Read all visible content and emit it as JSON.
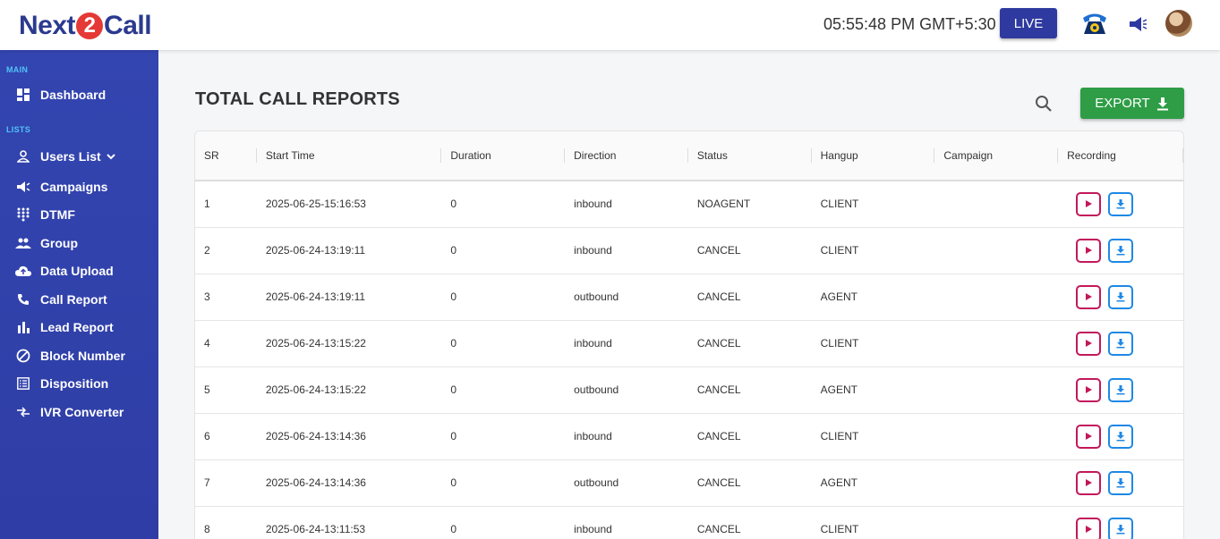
{
  "brand": {
    "pre": "Next",
    "mid": "2",
    "post": "Call"
  },
  "header": {
    "clock": "05:55:48 PM GMT+5:30",
    "live_label": "LIVE"
  },
  "sidebar": {
    "main_label": "MAIN",
    "lists_label": "LISTS",
    "items": [
      {
        "label": "Dashboard",
        "icon": "dashboard-icon"
      },
      {
        "label": "Users List",
        "icon": "user-icon"
      },
      {
        "label": "Campaigns",
        "icon": "megaphone-icon"
      },
      {
        "label": "DTMF",
        "icon": "dialpad-icon"
      },
      {
        "label": "Group",
        "icon": "group-icon"
      },
      {
        "label": "Data Upload",
        "icon": "cloud-upload-icon"
      },
      {
        "label": "Call Report",
        "icon": "phone-icon"
      },
      {
        "label": "Lead Report",
        "icon": "bar-chart-icon"
      },
      {
        "label": "Block Number",
        "icon": "block-icon"
      },
      {
        "label": "Disposition",
        "icon": "list-icon"
      },
      {
        "label": "IVR Converter",
        "icon": "convert-icon"
      }
    ]
  },
  "main": {
    "title": "TOTAL CALL REPORTS",
    "export_label": "EXPORT"
  },
  "table": {
    "columns": [
      "SR",
      "Start Time",
      "Duration",
      "Direction",
      "Status",
      "Hangup",
      "Campaign",
      "Recording"
    ],
    "rows": [
      [
        "1",
        "2025-06-25-15:16:53",
        "0",
        "inbound",
        "NOAGENT",
        "CLIENT",
        ""
      ],
      [
        "2",
        "2025-06-24-13:19:11",
        "0",
        "inbound",
        "CANCEL",
        "CLIENT",
        ""
      ],
      [
        "3",
        "2025-06-24-13:19:11",
        "0",
        "outbound",
        "CANCEL",
        "AGENT",
        ""
      ],
      [
        "4",
        "2025-06-24-13:15:22",
        "0",
        "inbound",
        "CANCEL",
        "CLIENT",
        ""
      ],
      [
        "5",
        "2025-06-24-13:15:22",
        "0",
        "outbound",
        "CANCEL",
        "AGENT",
        ""
      ],
      [
        "6",
        "2025-06-24-13:14:36",
        "0",
        "inbound",
        "CANCEL",
        "CLIENT",
        ""
      ],
      [
        "7",
        "2025-06-24-13:14:36",
        "0",
        "outbound",
        "CANCEL",
        "AGENT",
        ""
      ],
      [
        "8",
        "2025-06-24-13:11:53",
        "0",
        "inbound",
        "CANCEL",
        "CLIENT",
        ""
      ]
    ]
  },
  "colors": {
    "sidebar": "#3345b0",
    "accent": "#2f3aa0",
    "export": "#2e9d46",
    "play": "#c2185b",
    "download": "#1e88e5",
    "section_label": "#4fc3f7"
  }
}
